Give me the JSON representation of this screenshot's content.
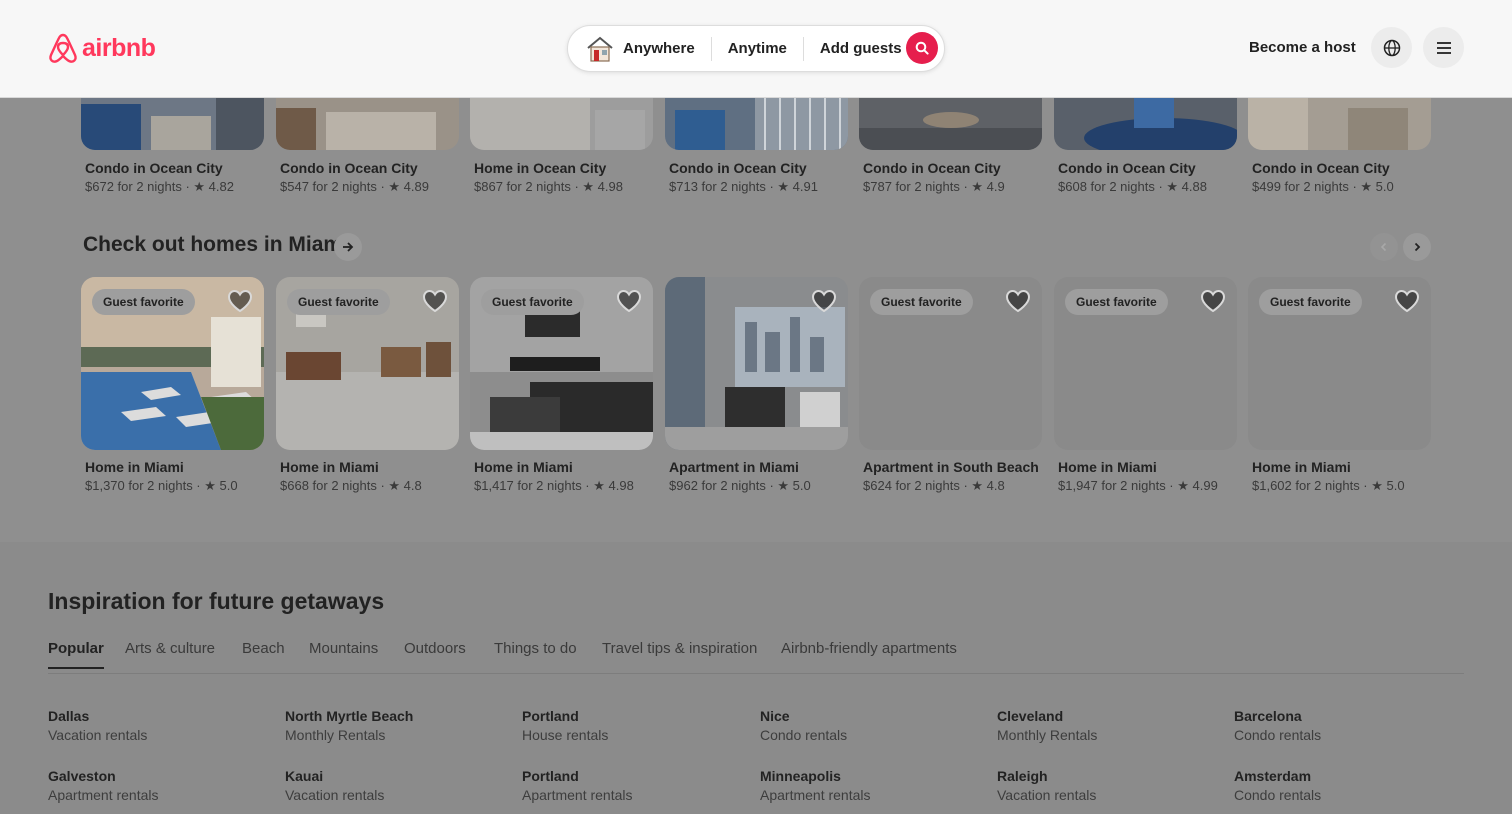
{
  "header": {
    "logo_text": "airbnb",
    "search": {
      "where": "Anywhere",
      "when": "Anytime",
      "guests": "Add guests"
    },
    "become_host": "Become a host"
  },
  "top_row": [
    {
      "title": "Condo in Ocean City",
      "sub": "$672 for 2 nights · ★ 4.82"
    },
    {
      "title": "Condo in Ocean City",
      "sub": "$547 for 2 nights · ★ 4.89"
    },
    {
      "title": "Home in Ocean City",
      "sub": "$867 for 2 nights · ★ 4.98"
    },
    {
      "title": "Condo in Ocean City",
      "sub": "$713 for 2 nights · ★ 4.91"
    },
    {
      "title": "Condo in Ocean City",
      "sub": "$787 for 2 nights · ★ 4.9"
    },
    {
      "title": "Condo in Ocean City",
      "sub": "$608 for 2 nights · ★ 4.88"
    },
    {
      "title": "Condo in Ocean City",
      "sub": "$499 for 2 nights · ★ 5.0"
    }
  ],
  "miami": {
    "title": "Check out homes in Miami",
    "badge": "Guest favorite",
    "cards": [
      {
        "title": "Home in Miami",
        "sub": "$1,370 for 2 nights · ★ 5.0"
      },
      {
        "title": "Home in Miami",
        "sub": "$668 for 2 nights · ★ 4.8"
      },
      {
        "title": "Home in Miami",
        "sub": "$1,417 for 2 nights · ★ 4.98"
      },
      {
        "title": "Apartment in Miami",
        "sub": "$962 for 2 nights · ★ 5.0"
      },
      {
        "title": "Apartment in South Beach",
        "sub": "$624 for 2 nights · ★ 4.8"
      },
      {
        "title": "Home in Miami",
        "sub": "$1,947 for 2 nights · ★ 4.99"
      },
      {
        "title": "Home in Miami",
        "sub": "$1,602 for 2 nights · ★ 5.0"
      }
    ]
  },
  "inspiration": {
    "title": "Inspiration for future getaways",
    "tabs": [
      "Popular",
      "Arts & culture",
      "Beach",
      "Mountains",
      "Outdoors",
      "Things to do",
      "Travel tips & inspiration",
      "Airbnb-friendly apartments"
    ],
    "destinations": [
      {
        "name": "Dallas",
        "type": "Vacation rentals"
      },
      {
        "name": "North Myrtle Beach",
        "type": "Monthly Rentals"
      },
      {
        "name": "Portland",
        "type": "House rentals"
      },
      {
        "name": "Nice",
        "type": "Condo rentals"
      },
      {
        "name": "Cleveland",
        "type": "Monthly Rentals"
      },
      {
        "name": "Barcelona",
        "type": "Condo rentals"
      },
      {
        "name": "Galveston",
        "type": "Apartment rentals"
      },
      {
        "name": "Kauai",
        "type": "Vacation rentals"
      },
      {
        "name": "Portland",
        "type": "Apartment rentals"
      },
      {
        "name": "Minneapolis",
        "type": "Apartment rentals"
      },
      {
        "name": "Raleigh",
        "type": "Vacation rentals"
      },
      {
        "name": "Amsterdam",
        "type": "Condo rentals"
      }
    ]
  },
  "colors": {
    "brand": "#ff385c",
    "search_button": "#e61e4d"
  },
  "icons": [
    "airbnb-logo-icon",
    "house-icon",
    "search-icon",
    "globe-icon",
    "menu-icon",
    "arrow-right-icon",
    "chevron-left-icon",
    "chevron-right-icon",
    "heart-icon"
  ]
}
